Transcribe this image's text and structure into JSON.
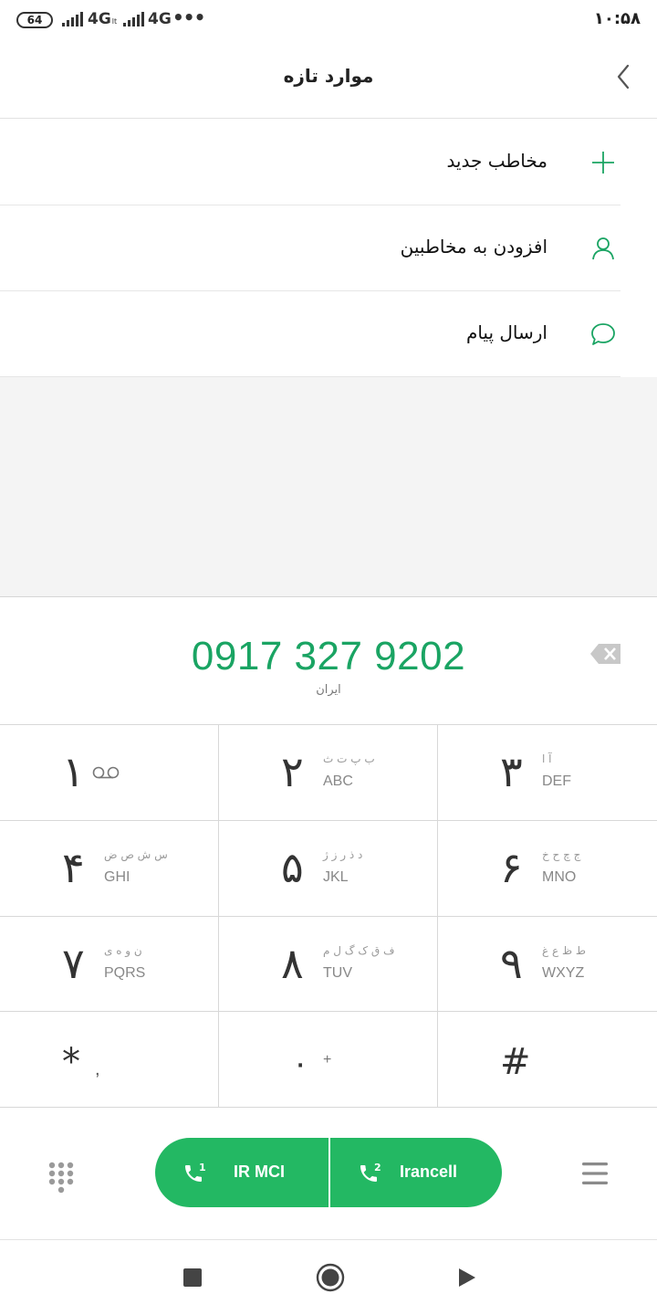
{
  "status_bar": {
    "battery": "64",
    "network1": "4G",
    "network1_sub": "lt",
    "network2": "4G",
    "time": "۱۰:۵۸"
  },
  "header": {
    "title": "موارد تازه",
    "back_icon": "chevron-left-icon"
  },
  "options": [
    {
      "label": "مخاطب جدید",
      "icon": "plus-icon"
    },
    {
      "label": "افزودن به مخاطبین",
      "icon": "person-icon"
    },
    {
      "label": "ارسال پیام",
      "icon": "chat-bubble-icon"
    }
  ],
  "dialer": {
    "number": "0917 327 9202",
    "location": "ایران"
  },
  "keypad": [
    {
      "digit": "۱",
      "fa": "",
      "en": ""
    },
    {
      "digit": "۲",
      "fa": "ب پ ت ث",
      "en": "ABC"
    },
    {
      "digit": "۳",
      "fa": "آ ا",
      "en": "DEF"
    },
    {
      "digit": "۴",
      "fa": "س ش ص ض",
      "en": "GHI"
    },
    {
      "digit": "۵",
      "fa": "د ذ ر ز ژ",
      "en": "JKL"
    },
    {
      "digit": "۶",
      "fa": "ج چ ح خ",
      "en": "MNO"
    },
    {
      "digit": "۷",
      "fa": "ن و ه ی",
      "en": "PQRS"
    },
    {
      "digit": "۸",
      "fa": "ف ق ک گ ل م",
      "en": "TUV"
    },
    {
      "digit": "۹",
      "fa": "ط ظ ع غ",
      "en": "WXYZ"
    },
    {
      "digit": "*",
      "fa": "",
      "en": ","
    },
    {
      "digit": "۰",
      "fa": "",
      "en": "+"
    },
    {
      "digit": "#",
      "fa": "",
      "en": ""
    }
  ],
  "calls": [
    {
      "sim": "1",
      "carrier": "IR MCI"
    },
    {
      "sim": "2",
      "carrier": "Irancell"
    }
  ],
  "colors": {
    "accent": "#1aa463",
    "call_button": "#23b863"
  }
}
